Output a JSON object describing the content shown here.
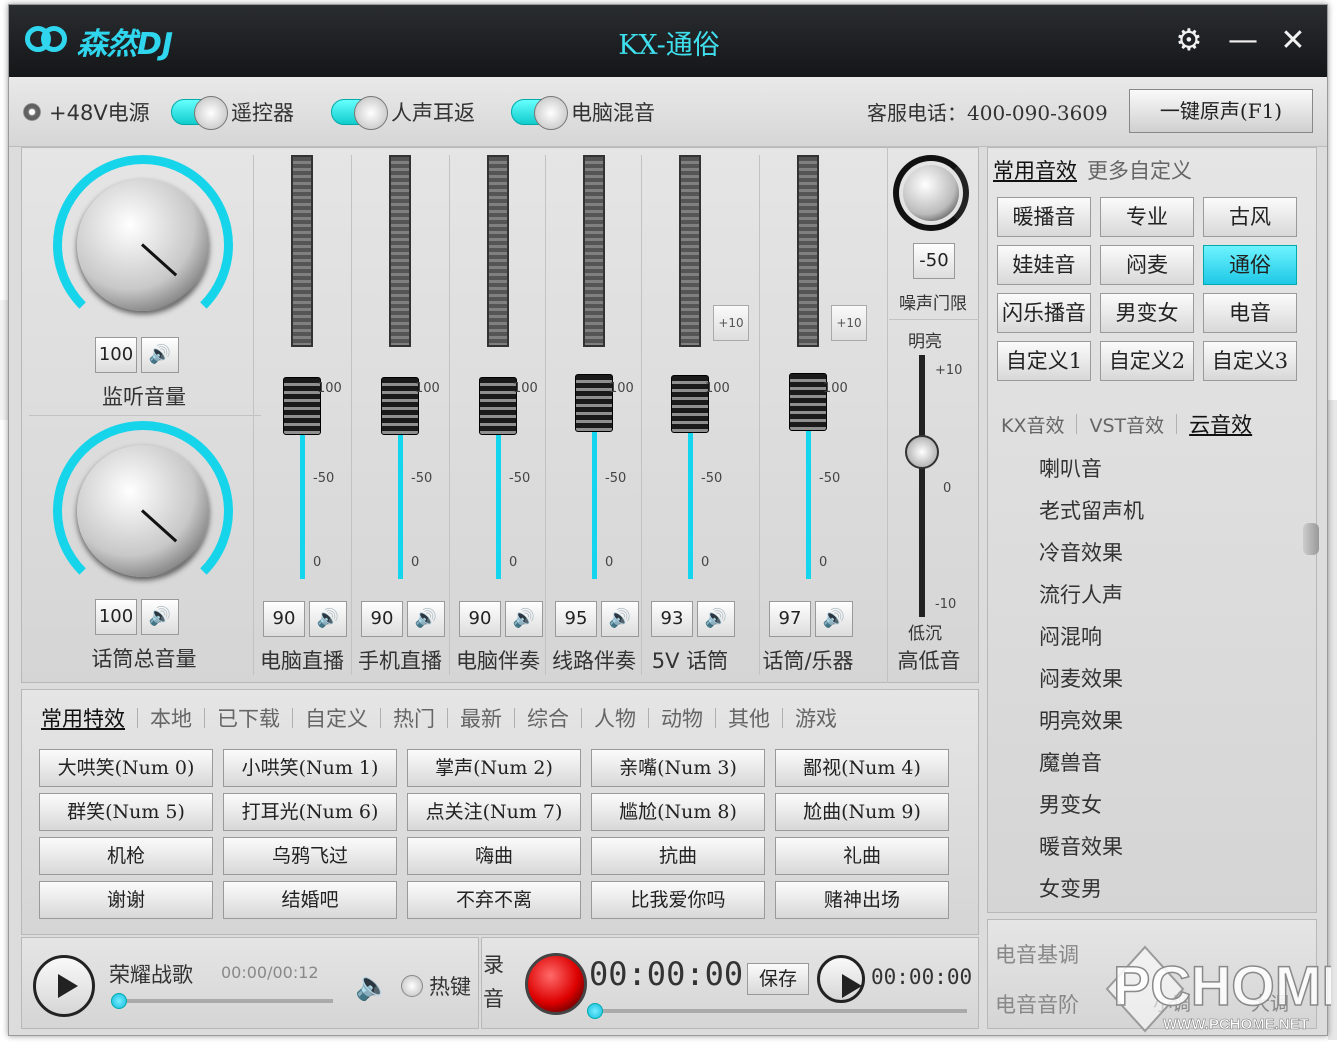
{
  "app": {
    "logo_text": "森然DJ",
    "title": "KX-通俗"
  },
  "window_controls": {
    "settings": "⚙",
    "minimize": "—",
    "close": "✕"
  },
  "toolbar": {
    "phantom_power": "+48V电源",
    "remote": "遥控器",
    "monitor": "人声耳返",
    "pc_mix": "电脑混音",
    "phone": "客服电话：400-090-3609",
    "one_key": "一键原声(F1)"
  },
  "knobs": {
    "monitor": {
      "value": "100",
      "label": "监听音量"
    },
    "mic_master": {
      "value": "100",
      "label": "话筒总音量"
    }
  },
  "channels": [
    {
      "value": "90",
      "label": "电脑直播",
      "level": 0.9
    },
    {
      "value": "90",
      "label": "手机直播",
      "level": 0.9
    },
    {
      "value": "90",
      "label": "电脑伴奏",
      "level": 0.9
    },
    {
      "value": "95",
      "label": "线路伴奏",
      "level": 0.95
    },
    {
      "value": "93",
      "label": "5V 话筒",
      "level": 0.93
    },
    {
      "value": "97",
      "label": "话筒/乐器",
      "level": 0.97
    }
  ],
  "fader_ticks": {
    "top": "100",
    "mid": "-50",
    "bottom": "0"
  },
  "plus10": "+10",
  "noise_gate": {
    "value": "-50",
    "label": "噪声门限"
  },
  "eq": {
    "bright": "明亮",
    "low": "低沉",
    "label": "高低音",
    "tick_top": "+10",
    "tick_mid": "0",
    "tick_bottom": "-10"
  },
  "effects_tabs": {
    "common": "常用音效",
    "more": "更多自定义"
  },
  "effect_buttons": [
    "暖播音",
    "专业",
    "古风",
    "娃娃音",
    "闷麦",
    "通俗",
    "闪乐播音",
    "男变女",
    "电音",
    "自定义1",
    "自定义2",
    "自定义3"
  ],
  "effect_selected": "通俗",
  "sub_tabs": {
    "kx": "KX音效",
    "vst": "VST音效",
    "cloud": "云音效"
  },
  "cloud_effects": [
    "喇叭音",
    "老式留声机",
    "冷音效果",
    "流行人声",
    "闷混响",
    "闷麦效果",
    "明亮效果",
    "魔兽音",
    "男变女",
    "暖音效果",
    "女变男"
  ],
  "sfx_tabs": [
    "常用特效",
    "本地",
    "已下载",
    "自定义",
    "热门",
    "最新",
    "综合",
    "人物",
    "动物",
    "其他",
    "游戏"
  ],
  "sfx_buttons": [
    "大哄笑(Num 0)",
    "小哄笑(Num 1)",
    "掌声(Num 2)",
    "亲嘴(Num 3)",
    "鄙视(Num 4)",
    "群笑(Num 5)",
    "打耳光(Num 6)",
    "点关注(Num 7)",
    "尴尬(Num 8)",
    "尬曲(Num 9)",
    "机枪",
    "乌鸦飞过",
    "嗨曲",
    "抗曲",
    "礼曲",
    "谢谢",
    "结婚吧",
    "不弃不离",
    "比我爱你吗",
    "赌神出场"
  ],
  "player": {
    "song": "荣耀战歌",
    "time": "00:00/00:12",
    "hotkey": "热键",
    "progress": 0.0
  },
  "recorder": {
    "label_1": "录",
    "label_2": "音",
    "time": "00:00:00",
    "save": "保存",
    "play_time": "00:00:00",
    "progress": 0.0
  },
  "edm": {
    "key_label": "电音基调",
    "scale_label": "电音音阶",
    "small": "小调",
    "big": "大调"
  },
  "watermark": {
    "brand": "PCHOME",
    "url": "WWW.PCHOME.NET"
  },
  "colors": {
    "accent": "#16d4ea",
    "record": "#d00000",
    "title_bg": "#1c1e20"
  }
}
